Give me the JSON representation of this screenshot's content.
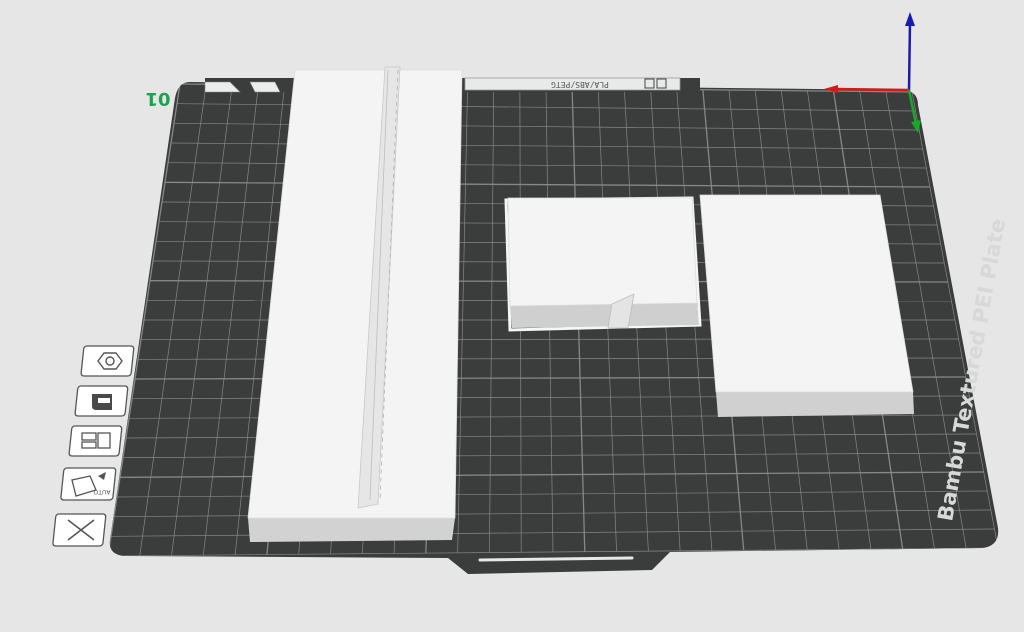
{
  "plate": {
    "number": "01",
    "name": "Bambu Textured PEI Plate",
    "label_strip": "PLA/ABS/PETG",
    "clone_marker": "01"
  },
  "colors": {
    "background": "#e6e6e6",
    "plate": "#3a3d3c",
    "grid": "#858886",
    "part": "#f4f4f4",
    "part_side": "#cfcfcf",
    "plate_number": "#1aa34a",
    "axis_x": "#d11a1a",
    "axis_y": "#18a82a",
    "axis_z": "#1a1ab0"
  },
  "plate_toolbar": {
    "buttons": [
      {
        "name": "orient-button",
        "icon": "hexagon-nut-icon"
      },
      {
        "name": "filament-settings-button",
        "icon": "filament-spool-icon"
      },
      {
        "name": "arrange-button",
        "icon": "arrange-layout-icon"
      },
      {
        "name": "auto-orient-button",
        "icon": "auto-orient-icon",
        "caption": "AUTO"
      },
      {
        "name": "delete-plate-button",
        "icon": "close-x-icon"
      }
    ]
  }
}
